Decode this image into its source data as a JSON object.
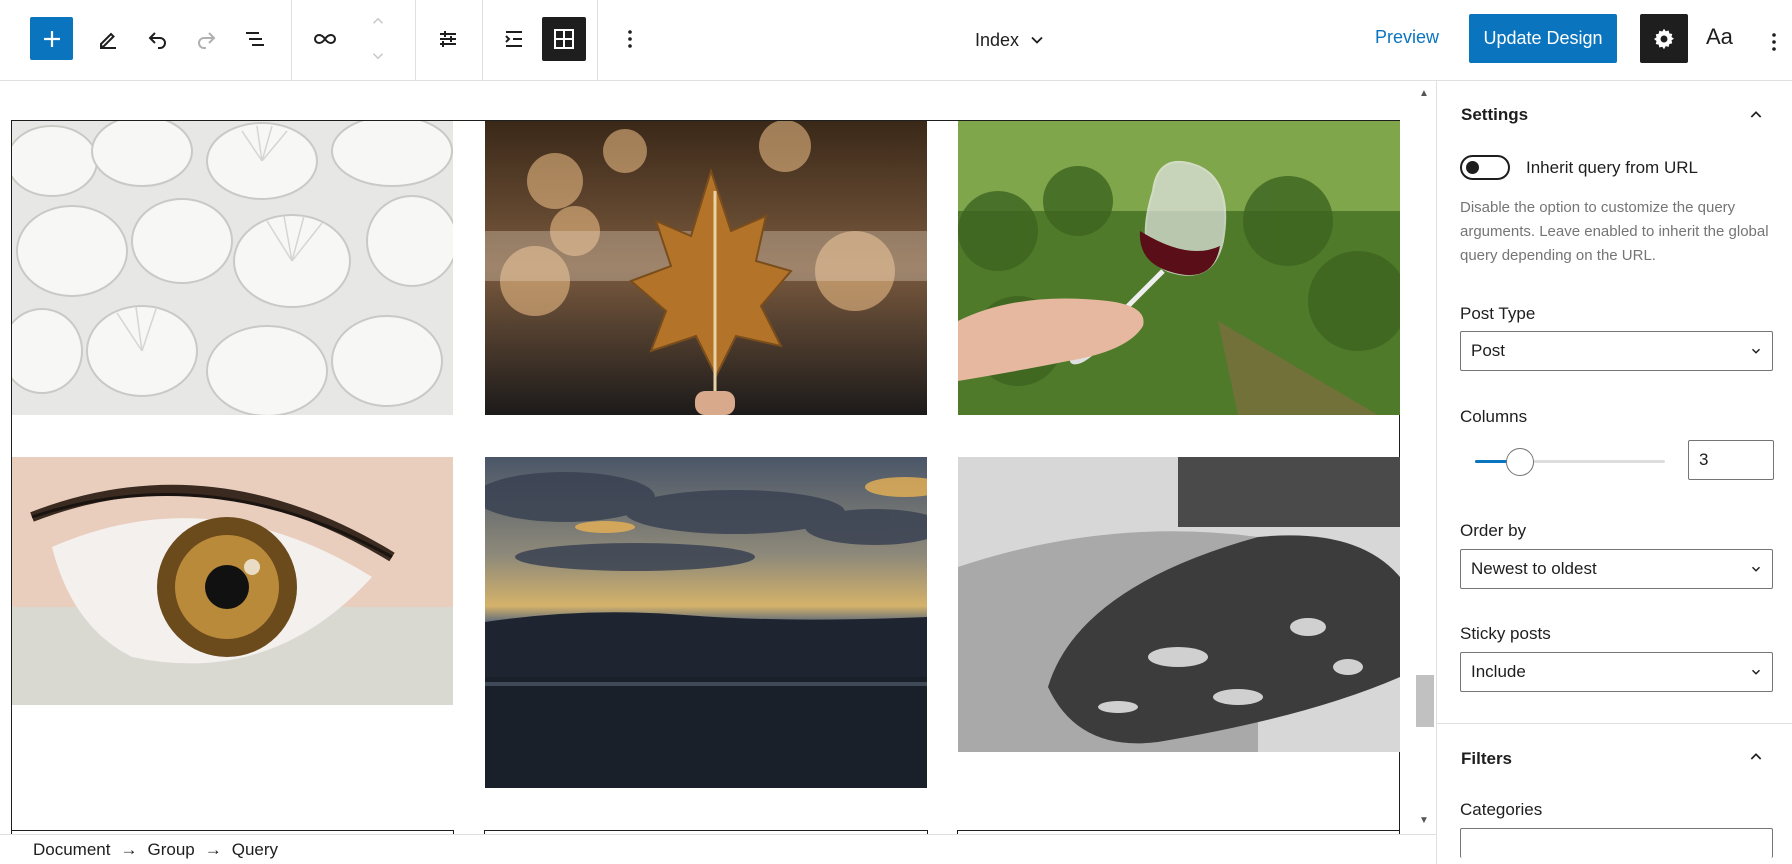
{
  "toolbar": {
    "document_title": "Index",
    "preview_label": "Preview",
    "update_label": "Update Design",
    "typography_label": "Aa",
    "colors": {
      "accent": "#0a74bf",
      "dark": "#1e1e1e"
    }
  },
  "icons": [
    "plus-icon",
    "pencil-icon",
    "undo-icon",
    "redo-icon",
    "list-view-icon",
    "link-icon",
    "chevron-up-icon",
    "chevron-down-icon",
    "sliders-icon",
    "list-indent-icon",
    "grid-icon",
    "more-vertical-icon",
    "gear-icon"
  ],
  "posts": [
    {
      "subject": "white seashells"
    },
    {
      "subject": "autumn maple leaf"
    },
    {
      "subject": "red wine glass in vineyard"
    },
    {
      "subject": "close-up of eye"
    },
    {
      "subject": "sunset over sea"
    },
    {
      "subject": "black and white boat"
    }
  ],
  "sidebar": {
    "settings_title": "Settings",
    "inherit_label": "Inherit query from URL",
    "inherit_enabled": false,
    "inherit_help": "Disable the option to customize the query arguments. Leave enabled to inherit the global query depending on the URL.",
    "post_type_label": "Post Type",
    "post_type_value": "Post",
    "columns_label": "Columns",
    "columns_value": "3",
    "order_by_label": "Order by",
    "order_by_value": "Newest to oldest",
    "sticky_label": "Sticky posts",
    "sticky_value": "Include",
    "filters_title": "Filters",
    "categories_label": "Categories"
  },
  "breadcrumb": [
    "Document",
    "Group",
    "Query"
  ],
  "breadcrumb_separator": "→"
}
